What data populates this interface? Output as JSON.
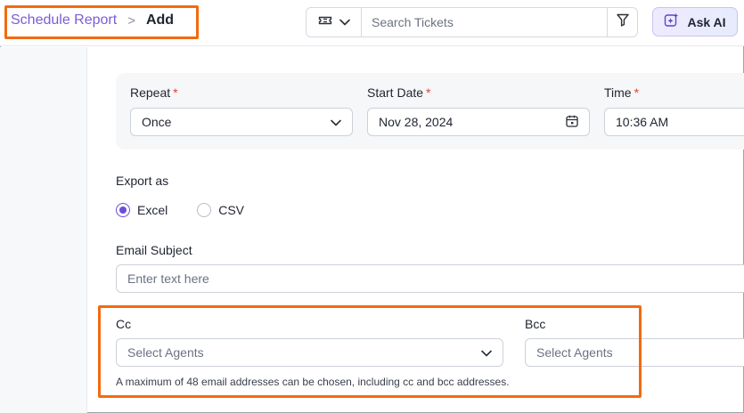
{
  "breadcrumb": {
    "parent": "Schedule Report",
    "separator": ">",
    "current": "Add"
  },
  "search": {
    "placeholder": "Search Tickets"
  },
  "ask_ai": {
    "label": "Ask AI"
  },
  "schedule": {
    "repeat": {
      "label": "Repeat",
      "required_mark": "*",
      "value": "Once"
    },
    "start_date": {
      "label": "Start Date",
      "required_mark": "*",
      "value": "Nov 28, 2024"
    },
    "time": {
      "label": "Time",
      "required_mark": "*",
      "value": "10:36 AM"
    }
  },
  "export": {
    "label": "Export as",
    "options": [
      {
        "label": "Excel",
        "selected": true
      },
      {
        "label": "CSV",
        "selected": false
      }
    ]
  },
  "email_subject": {
    "label": "Email Subject",
    "placeholder": "Enter text here"
  },
  "cc": {
    "label": "Cc",
    "placeholder": "Select Agents"
  },
  "bcc": {
    "label": "Bcc",
    "placeholder": "Select Agents"
  },
  "hint": "A maximum of 48 email addresses can be chosen, including cc and bcc addresses.",
  "colors": {
    "accent": "#6d4ed6",
    "link": "#7c5cd6",
    "highlight": "#f26b10",
    "required": "#e0433b"
  },
  "icons": [
    "ticket-icon",
    "chevron-down-icon",
    "filter-icon",
    "ai-sparkle-icon",
    "calendar-icon"
  ]
}
